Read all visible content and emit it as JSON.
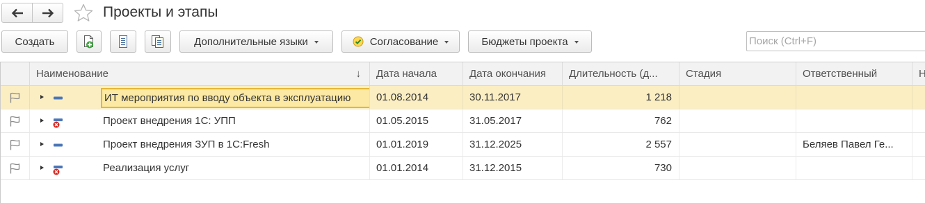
{
  "title": "Проекты и этапы",
  "colors": {
    "selected_row": "#fbeec3",
    "focused_cell_border": "#e4b73b",
    "status_ok": "#4a76b8",
    "status_error": "#d9241c",
    "title_text": "#333333"
  },
  "nav": {
    "back_icon": "arrow-left-icon",
    "forward_icon": "arrow-right-icon",
    "favorite_icon": "star-outline-icon"
  },
  "toolbar": {
    "create_label": "Создать",
    "add_group_icon": "add-document-icon",
    "list_icon": "list-document-icon",
    "copy_icon": "copy-documents-icon",
    "languages_label": "Дополнительные языки",
    "approval_label": "Согласование",
    "approval_icon": "approval-check-icon",
    "budgets_label": "Бюджеты проекта"
  },
  "search": {
    "placeholder": "Поиск (Ctrl+F)",
    "value": ""
  },
  "table": {
    "columns": [
      {
        "label": "Наименование",
        "sort": "descending"
      },
      {
        "label": "Дата начала"
      },
      {
        "label": "Дата окончания"
      },
      {
        "label": "Длительность (д..."
      },
      {
        "label": "Стадия"
      },
      {
        "label": "Ответственный"
      },
      {
        "label": "Н"
      }
    ],
    "rows": [
      {
        "name": "ИТ мероприятия по вводу объекта в эксплуатацию",
        "start": "01.08.2014",
        "end": "30.11.2017",
        "duration": "1 218",
        "stage": "",
        "responsible": "",
        "status": "active",
        "selected": true
      },
      {
        "name": "Проект внедрения 1С: УПП",
        "start": "01.05.2015",
        "end": "31.05.2017",
        "duration": "762",
        "stage": "",
        "responsible": "",
        "status": "deleted",
        "selected": false
      },
      {
        "name": "Проект внедрения ЗУП в 1С:Fresh",
        "start": "01.01.2019",
        "end": "31.12.2025",
        "duration": "2 557",
        "stage": "",
        "responsible": "Беляев Павел Ге...",
        "status": "active",
        "selected": false
      },
      {
        "name": "Реализация услуг",
        "start": "01.01.2014",
        "end": "31.12.2015",
        "duration": "730",
        "stage": "",
        "responsible": "",
        "status": "deleted",
        "selected": false
      }
    ]
  }
}
